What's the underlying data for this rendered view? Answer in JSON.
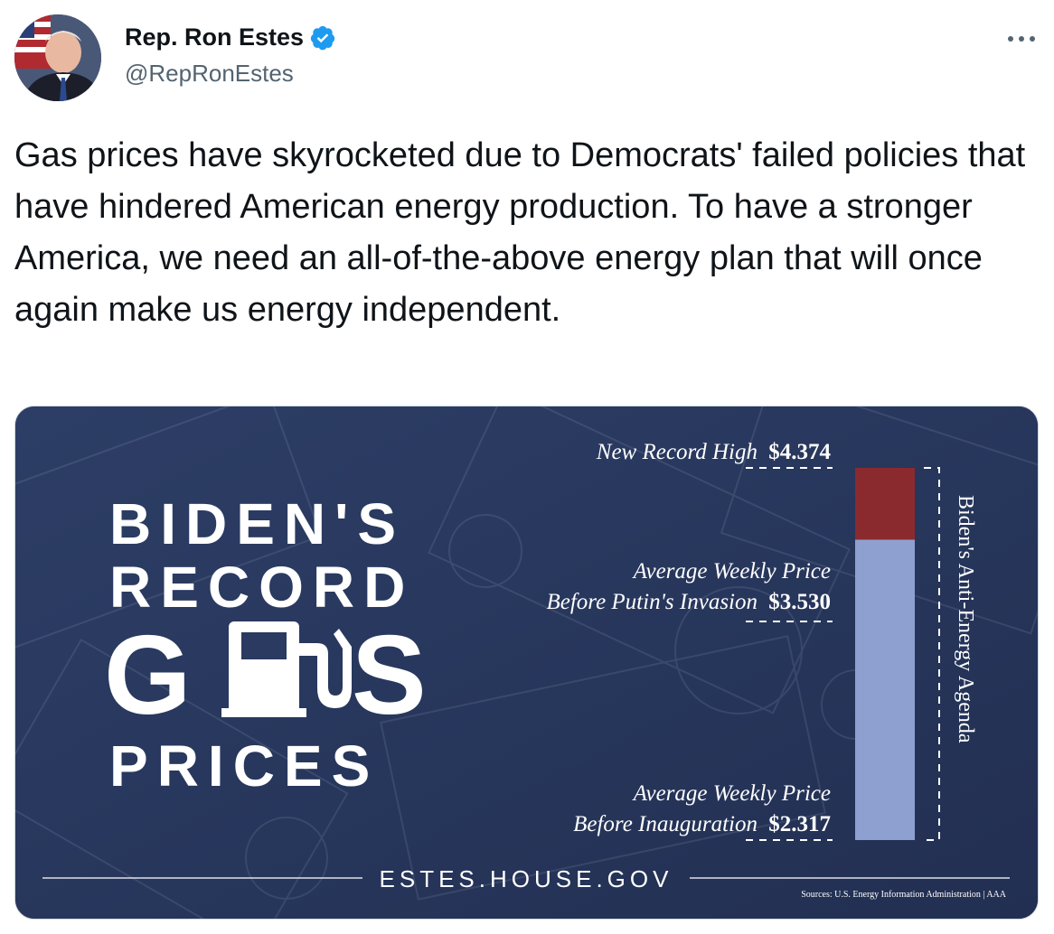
{
  "author": {
    "display_name": "Rep. Ron Estes",
    "handle": "@RepRonEstes",
    "verified_icon": "verified-badge-icon"
  },
  "menu": {
    "more_icon": "more-horizontal-icon"
  },
  "tweet": {
    "text": "Gas prices have skyrocketed due to Democrats' failed policies that have hindered American energy production. To have a stronger America, we need an all-of-the-above energy plan that will once again make us energy independent."
  },
  "media": {
    "headline": {
      "line1": "BIDEN'S",
      "line2": "RECORD",
      "line3_a": "G",
      "line3_b": "S",
      "line4": "PRICES"
    },
    "pump_icon": "gas-pump-icon",
    "labels": {
      "record_high": "New Record High",
      "record_high_value": "$4.374",
      "putin_line1": "Average Weekly Price",
      "putin_line2": "Before Putin's Invasion",
      "putin_value": "$3.530",
      "inaug_line1": "Average Weekly Price",
      "inaug_line2": "Before Inauguration",
      "inaug_value": "$2.317",
      "bracket_label": "Biden's Anti-Energy Agenda"
    },
    "footer": {
      "website": "ESTES.HOUSE.GOV",
      "sources": "Sources: U.S. Energy Information Administration | AAA"
    },
    "colors": {
      "background": "#27375c",
      "increase_bar": "#8b2a2e",
      "base_bar": "#8ea0d0",
      "text": "#ffffff"
    },
    "bar_values": {
      "max": 4.374,
      "split": 3.53,
      "base_top": 2.317
    }
  }
}
